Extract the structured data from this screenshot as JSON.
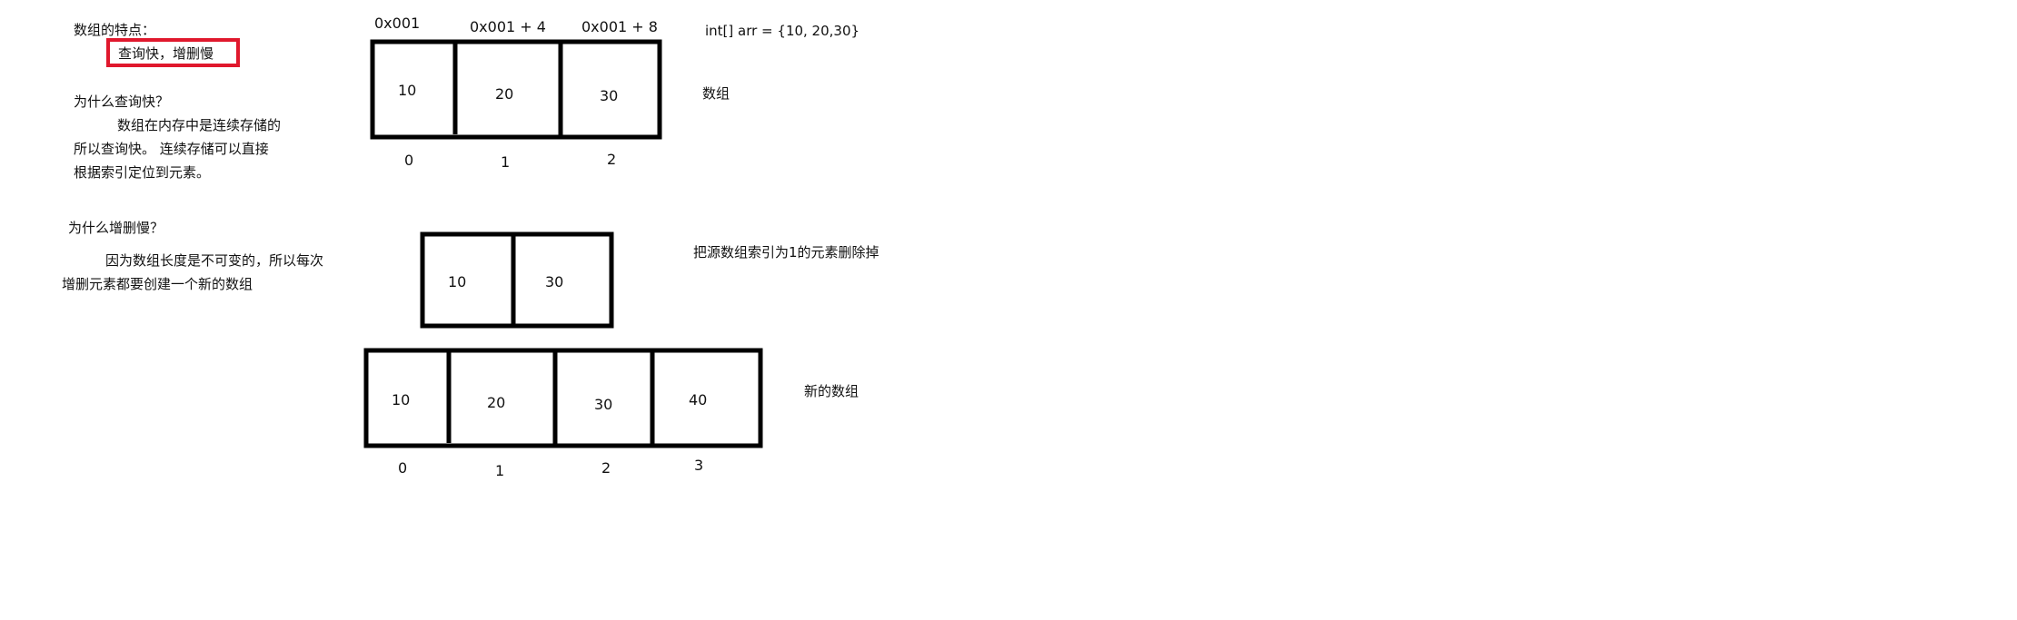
{
  "notes": {
    "title": "数组的特点：",
    "feature": "查询快，增删慢",
    "q1": "为什么查询快？",
    "a1_line1": "数组在内存中是连续存储的",
    "a1_line2": "所以查询快。 连续存储可以直接",
    "a1_line3": "根据索引定位到元素。",
    "q2": "为什么增删慢？",
    "a2_line1": "因为数组长度是不可变的，所以每次",
    "a2_line2": "增删元素都要创建一个新的数组"
  },
  "array1": {
    "addresses": [
      "0x001",
      "0x001 + 4",
      "0x001 + 8"
    ],
    "values": [
      "10",
      "20",
      "30"
    ],
    "indices": [
      "0",
      "1",
      "2"
    ],
    "declaration": "int[] arr = {10, 20,30}",
    "label": "数组"
  },
  "array2": {
    "values": [
      "10",
      "30"
    ],
    "label": "把源数组索引为1的元素删除掉"
  },
  "array3": {
    "values": [
      "10",
      "20",
      "30",
      "40"
    ],
    "indices": [
      "0",
      "1",
      "2",
      "3"
    ],
    "label": "新的数组"
  },
  "colors": {
    "highlight": "#e0182d",
    "stroke": "#000000"
  }
}
